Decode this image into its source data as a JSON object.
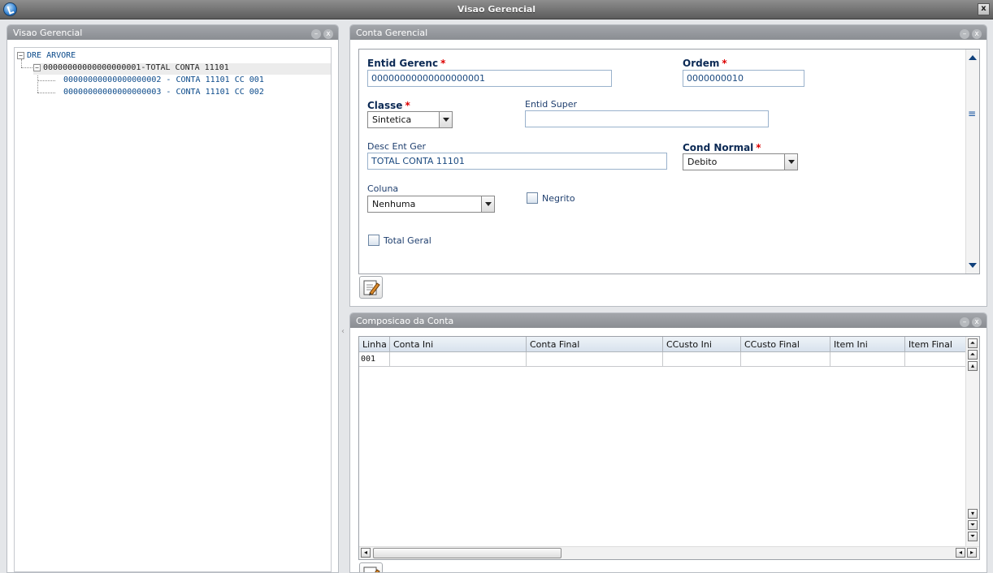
{
  "window": {
    "title": "Visao Gerencial",
    "close_label": "x"
  },
  "tree_panel": {
    "title": "Visao Gerencial",
    "root": "DRE ARVORE",
    "node": "00000000000000000001-TOTAL CONTA 11101",
    "children": [
      "00000000000000000002 - CONTA 11101 CC 001",
      "00000000000000000003 - CONTA 11101 CC 002"
    ],
    "expander_open": "−"
  },
  "form_panel": {
    "title": "Conta Gerencial",
    "entid_gerenc": {
      "label": "Entid Gerenc",
      "value": "00000000000000000001"
    },
    "ordem": {
      "label": "Ordem",
      "value": "0000000010"
    },
    "classe": {
      "label": "Classe",
      "value": "Sintetica"
    },
    "entid_super": {
      "label": "Entid Super",
      "value": ""
    },
    "desc_ent_ger": {
      "label": "Desc Ent Ger",
      "value": "TOTAL CONTA 11101"
    },
    "cond_normal": {
      "label": "Cond Normal",
      "value": "Debito"
    },
    "coluna": {
      "label": "Coluna",
      "value": "Nenhuma"
    },
    "negrito": {
      "label": "Negrito",
      "checked": false
    },
    "total_geral": {
      "label": "Total Geral",
      "checked": false
    },
    "required_mark": "*",
    "scroll_mid_glyph": "≡"
  },
  "grid_panel": {
    "title": "Composicao da Conta",
    "columns": [
      "Linha",
      "Conta Ini",
      "Conta Final",
      "CCusto Ini",
      "CCusto Final",
      "Item Ini",
      "Item Final"
    ],
    "rows": [
      [
        "001",
        "",
        "",
        "",
        "",
        "",
        ""
      ]
    ]
  },
  "panel_buttons": {
    "minimize": "–",
    "close": "x"
  },
  "colors": {
    "titlebar": "#6e6e6e",
    "panel_header": "#9a9da2",
    "label": "#0c2a55",
    "required": "#dd0000"
  }
}
